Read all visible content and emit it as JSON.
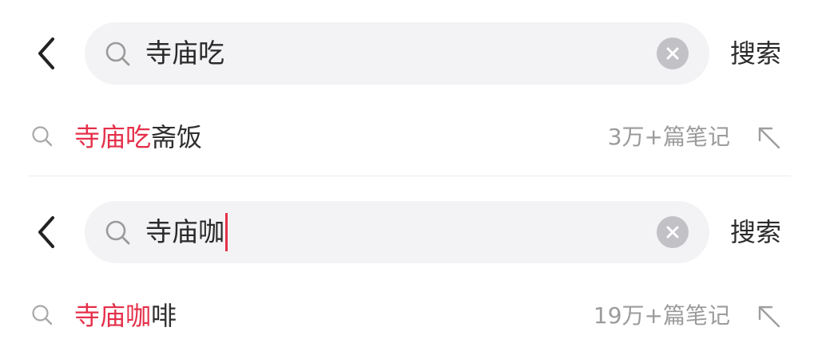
{
  "panels": [
    {
      "query": "寺庙吃",
      "show_caret": false,
      "search_button": "搜索",
      "suggestion": {
        "highlight": "寺庙吃",
        "rest": "斋饭",
        "count": "3万+篇笔记"
      }
    },
    {
      "query": "寺庙咖",
      "show_caret": true,
      "search_button": "搜索",
      "suggestion": {
        "highlight": "寺庙咖",
        "rest": "啡",
        "count": "19万+篇笔记"
      }
    }
  ],
  "colors": {
    "highlight": "#e5304a",
    "search_bg": "#f3f3f5",
    "muted_text": "#9b9b9b",
    "clear_bg": "#c2c2c6"
  },
  "icons": {
    "back": "chevron-left-icon",
    "search": "magnifier-icon",
    "clear": "clear-x-icon",
    "fill": "arrow-up-left-icon"
  }
}
